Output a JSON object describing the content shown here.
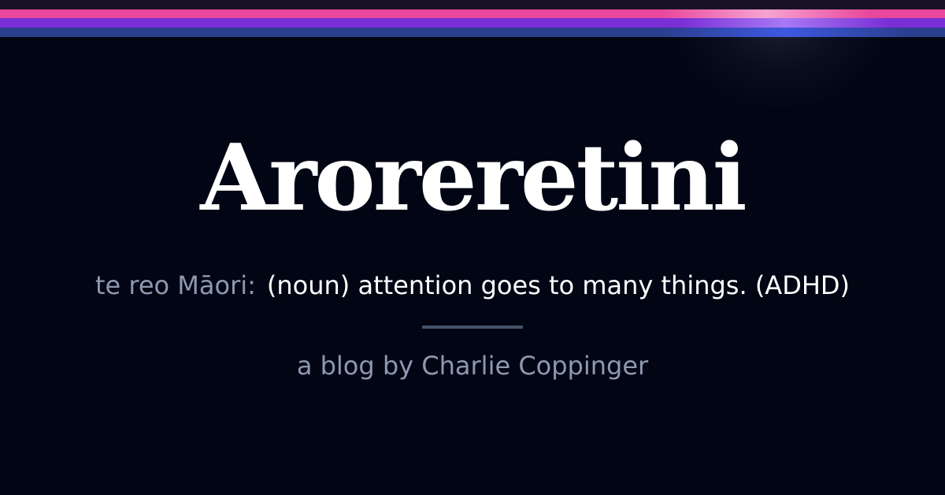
{
  "brand": {
    "title": "Aroreretini",
    "definition_label": "te reo Māori:",
    "definition_text": "(noun) attention goes to many things. (ADHD)",
    "byline": "a blog by Charlie Coppinger"
  },
  "colors": {
    "background": "#020614",
    "stripe_pink": "#e8479b",
    "stripe_purple": "#7a2fd6",
    "stripe_blue": "#2b3f8f",
    "title": "#ffffff",
    "muted_text": "#8d98b1",
    "divider": "#44536b"
  }
}
